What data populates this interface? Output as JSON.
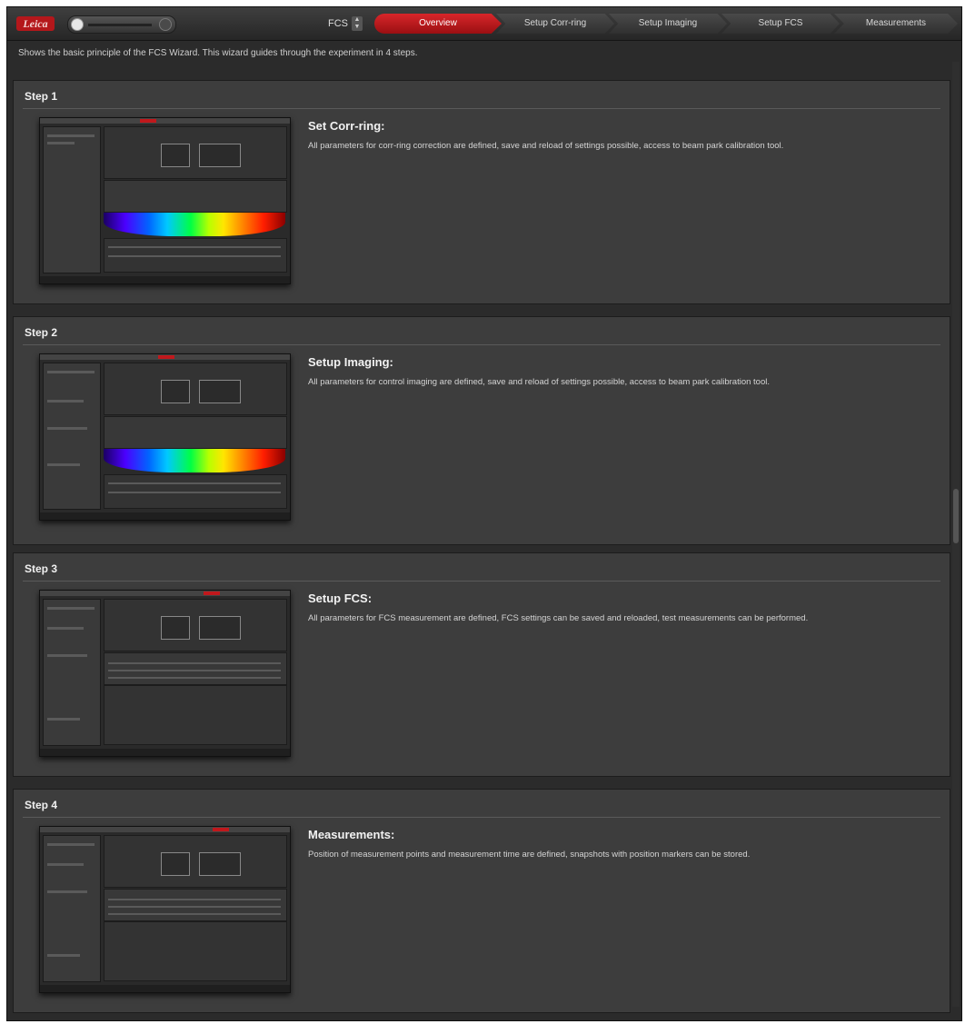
{
  "toolbar": {
    "logo_text": "Leica",
    "mode_select_value": "FCS",
    "tabs": [
      {
        "label": "Overview",
        "active": true
      },
      {
        "label": "Setup Corr-ring",
        "active": false
      },
      {
        "label": "Setup Imaging",
        "active": false
      },
      {
        "label": "Setup FCS",
        "active": false
      },
      {
        "label": "Measurements",
        "active": false
      }
    ]
  },
  "description": "Shows the basic principle of the FCS Wizard. This wizard guides through the experiment in 4 steps.",
  "steps": [
    {
      "header": "Step 1",
      "title": "Set Corr-ring:",
      "desc": "All parameters for corr-ring correction are defined, save and reload of settings possible, access to beam park calibration tool."
    },
    {
      "header": "Step 2",
      "title": "Setup Imaging:",
      "desc": "All parameters for control imaging are defined, save and reload of settings possible, access to beam park calibration tool."
    },
    {
      "header": "Step 3",
      "title": "Setup FCS:",
      "desc": "All parameters for FCS measurement are defined, FCS settings can be saved and reloaded, test measurements can be performed."
    },
    {
      "header": "Step 4",
      "title": "Measurements:",
      "desc": "Position of measurement points and measurement time are defined, snapshots with position markers can be stored."
    }
  ],
  "colors": {
    "accent": "#c0181c",
    "background": "#2b2b2b",
    "panel": "#3d3d3d"
  }
}
